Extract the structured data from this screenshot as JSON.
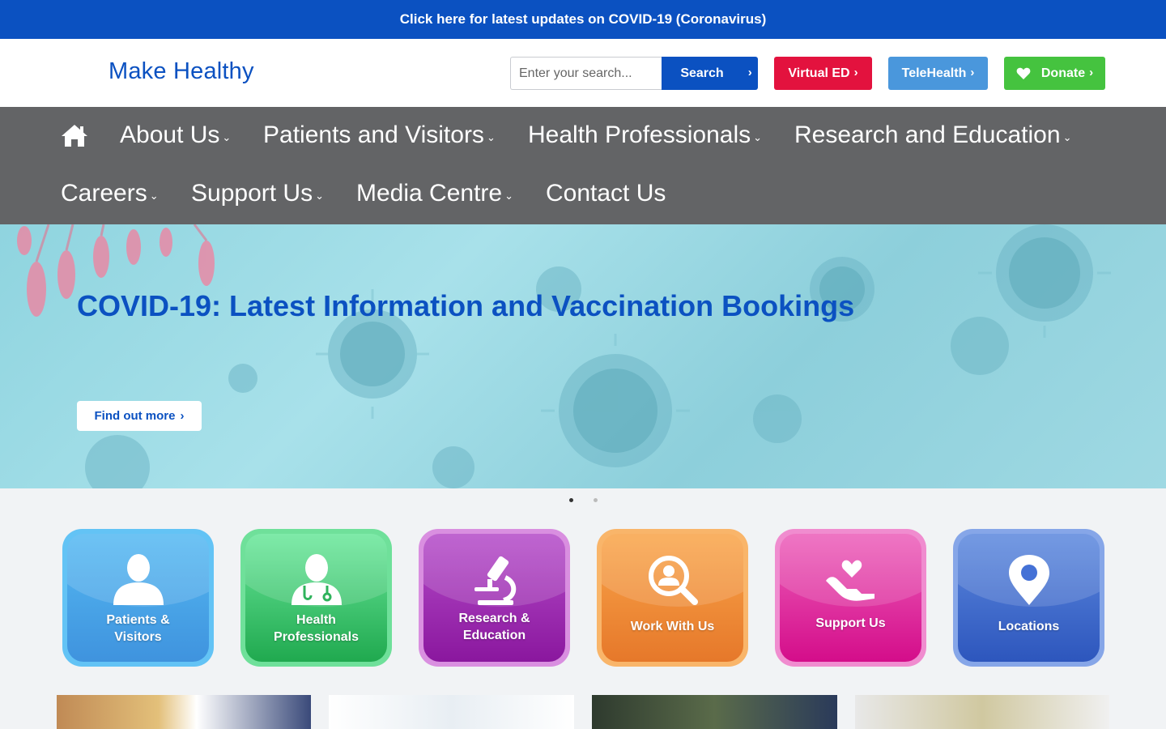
{
  "alert": {
    "text": "Click here for latest updates on COVID-19 (Coronavirus)"
  },
  "header": {
    "logo": "Make Healthy",
    "search": {
      "placeholder": "Enter your search...",
      "value": "",
      "button_label": "Search"
    },
    "buttons": {
      "virtual_ed": "Virtual ED",
      "telehealth": "TeleHealth",
      "donate": "Donate"
    }
  },
  "nav": {
    "items": [
      {
        "label": "About Us",
        "has_dropdown": true
      },
      {
        "label": "Patients and Visitors",
        "has_dropdown": true
      },
      {
        "label": "Health Professionals",
        "has_dropdown": true
      },
      {
        "label": "Research and Education",
        "has_dropdown": true
      },
      {
        "label": "Careers",
        "has_dropdown": true
      },
      {
        "label": "Support Us",
        "has_dropdown": true
      },
      {
        "label": "Media Centre",
        "has_dropdown": true
      },
      {
        "label": "Contact Us",
        "has_dropdown": false
      }
    ]
  },
  "hero": {
    "title": "COVID-19: Latest Information and Vaccination Bookings",
    "button_label": "Find out more",
    "slides_count": 2,
    "active_slide": 1
  },
  "tiles": [
    {
      "label_line1": "Patients &",
      "label_line2": "Visitors",
      "icon": "person-icon",
      "color": "#46a9e8"
    },
    {
      "label_line1": "Health",
      "label_line2": "Professionals",
      "icon": "doctor-icon",
      "color": "#2fc465"
    },
    {
      "label_line1": "Research &",
      "label_line2": "Education",
      "icon": "microscope-icon",
      "color": "#a12eb8"
    },
    {
      "label_line1": "Work With Us",
      "label_line2": "",
      "icon": "search-person-icon",
      "color": "#f0852a"
    },
    {
      "label_line1": "Support Us",
      "label_line2": "",
      "icon": "heart-hand-icon",
      "color": "#e0299a"
    },
    {
      "label_line1": "Locations",
      "label_line2": "",
      "icon": "location-pin-icon",
      "color": "#3a6fd1"
    }
  ],
  "colors": {
    "brand_blue": "#0b51c1",
    "nav_grey": "#636466",
    "virtual_ed_red": "#e3123e",
    "telehealth_blue": "#4a97dc",
    "donate_green": "#45c33f"
  }
}
